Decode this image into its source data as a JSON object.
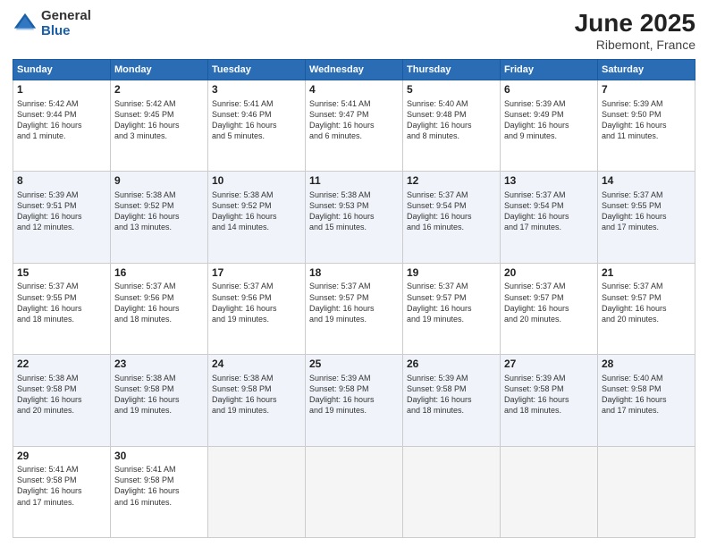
{
  "header": {
    "logo_general": "General",
    "logo_blue": "Blue",
    "title": "June 2025",
    "location": "Ribemont, France"
  },
  "days_of_week": [
    "Sunday",
    "Monday",
    "Tuesday",
    "Wednesday",
    "Thursday",
    "Friday",
    "Saturday"
  ],
  "weeks": [
    [
      {
        "day": 1,
        "info": "Sunrise: 5:42 AM\nSunset: 9:44 PM\nDaylight: 16 hours\nand 1 minute."
      },
      {
        "day": 2,
        "info": "Sunrise: 5:42 AM\nSunset: 9:45 PM\nDaylight: 16 hours\nand 3 minutes."
      },
      {
        "day": 3,
        "info": "Sunrise: 5:41 AM\nSunset: 9:46 PM\nDaylight: 16 hours\nand 5 minutes."
      },
      {
        "day": 4,
        "info": "Sunrise: 5:41 AM\nSunset: 9:47 PM\nDaylight: 16 hours\nand 6 minutes."
      },
      {
        "day": 5,
        "info": "Sunrise: 5:40 AM\nSunset: 9:48 PM\nDaylight: 16 hours\nand 8 minutes."
      },
      {
        "day": 6,
        "info": "Sunrise: 5:39 AM\nSunset: 9:49 PM\nDaylight: 16 hours\nand 9 minutes."
      },
      {
        "day": 7,
        "info": "Sunrise: 5:39 AM\nSunset: 9:50 PM\nDaylight: 16 hours\nand 11 minutes."
      }
    ],
    [
      {
        "day": 8,
        "info": "Sunrise: 5:39 AM\nSunset: 9:51 PM\nDaylight: 16 hours\nand 12 minutes."
      },
      {
        "day": 9,
        "info": "Sunrise: 5:38 AM\nSunset: 9:52 PM\nDaylight: 16 hours\nand 13 minutes."
      },
      {
        "day": 10,
        "info": "Sunrise: 5:38 AM\nSunset: 9:52 PM\nDaylight: 16 hours\nand 14 minutes."
      },
      {
        "day": 11,
        "info": "Sunrise: 5:38 AM\nSunset: 9:53 PM\nDaylight: 16 hours\nand 15 minutes."
      },
      {
        "day": 12,
        "info": "Sunrise: 5:37 AM\nSunset: 9:54 PM\nDaylight: 16 hours\nand 16 minutes."
      },
      {
        "day": 13,
        "info": "Sunrise: 5:37 AM\nSunset: 9:54 PM\nDaylight: 16 hours\nand 17 minutes."
      },
      {
        "day": 14,
        "info": "Sunrise: 5:37 AM\nSunset: 9:55 PM\nDaylight: 16 hours\nand 17 minutes."
      }
    ],
    [
      {
        "day": 15,
        "info": "Sunrise: 5:37 AM\nSunset: 9:55 PM\nDaylight: 16 hours\nand 18 minutes."
      },
      {
        "day": 16,
        "info": "Sunrise: 5:37 AM\nSunset: 9:56 PM\nDaylight: 16 hours\nand 18 minutes."
      },
      {
        "day": 17,
        "info": "Sunrise: 5:37 AM\nSunset: 9:56 PM\nDaylight: 16 hours\nand 19 minutes."
      },
      {
        "day": 18,
        "info": "Sunrise: 5:37 AM\nSunset: 9:57 PM\nDaylight: 16 hours\nand 19 minutes."
      },
      {
        "day": 19,
        "info": "Sunrise: 5:37 AM\nSunset: 9:57 PM\nDaylight: 16 hours\nand 19 minutes."
      },
      {
        "day": 20,
        "info": "Sunrise: 5:37 AM\nSunset: 9:57 PM\nDaylight: 16 hours\nand 20 minutes."
      },
      {
        "day": 21,
        "info": "Sunrise: 5:37 AM\nSunset: 9:57 PM\nDaylight: 16 hours\nand 20 minutes."
      }
    ],
    [
      {
        "day": 22,
        "info": "Sunrise: 5:38 AM\nSunset: 9:58 PM\nDaylight: 16 hours\nand 20 minutes."
      },
      {
        "day": 23,
        "info": "Sunrise: 5:38 AM\nSunset: 9:58 PM\nDaylight: 16 hours\nand 19 minutes."
      },
      {
        "day": 24,
        "info": "Sunrise: 5:38 AM\nSunset: 9:58 PM\nDaylight: 16 hours\nand 19 minutes."
      },
      {
        "day": 25,
        "info": "Sunrise: 5:39 AM\nSunset: 9:58 PM\nDaylight: 16 hours\nand 19 minutes."
      },
      {
        "day": 26,
        "info": "Sunrise: 5:39 AM\nSunset: 9:58 PM\nDaylight: 16 hours\nand 18 minutes."
      },
      {
        "day": 27,
        "info": "Sunrise: 5:39 AM\nSunset: 9:58 PM\nDaylight: 16 hours\nand 18 minutes."
      },
      {
        "day": 28,
        "info": "Sunrise: 5:40 AM\nSunset: 9:58 PM\nDaylight: 16 hours\nand 17 minutes."
      }
    ],
    [
      {
        "day": 29,
        "info": "Sunrise: 5:41 AM\nSunset: 9:58 PM\nDaylight: 16 hours\nand 17 minutes."
      },
      {
        "day": 30,
        "info": "Sunrise: 5:41 AM\nSunset: 9:58 PM\nDaylight: 16 hours\nand 16 minutes."
      },
      null,
      null,
      null,
      null,
      null
    ]
  ]
}
